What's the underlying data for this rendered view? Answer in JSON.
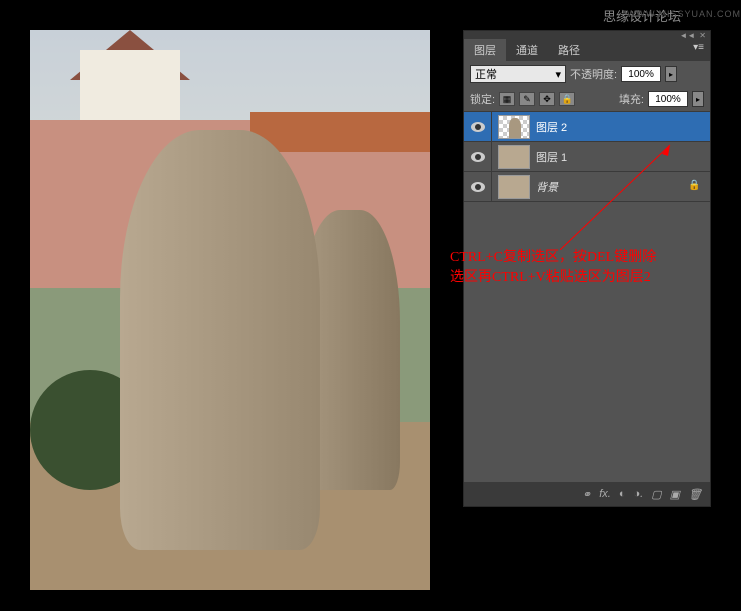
{
  "watermark": {
    "text": "思缘设计论坛",
    "url": "WWW.MISSYUAN.COM"
  },
  "panel": {
    "tabs": {
      "layers": "图层",
      "channels": "通道",
      "paths": "路径"
    },
    "blend": {
      "mode": "正常",
      "opacity_label": "不透明度:",
      "opacity_value": "100%"
    },
    "lock": {
      "label": "锁定:",
      "fill_label": "填充:",
      "fill_value": "100%"
    },
    "layers": [
      {
        "name": "图层 2",
        "selected": true,
        "checker": true
      },
      {
        "name": "图层 1",
        "selected": false,
        "checker": false
      },
      {
        "name": "背景",
        "selected": false,
        "locked": true,
        "italic": true
      }
    ]
  },
  "annotation": {
    "line1": "CTRL+C复制选区，按DEL键删除",
    "line2": "选区再CTRL+V粘贴选区为图层2"
  }
}
